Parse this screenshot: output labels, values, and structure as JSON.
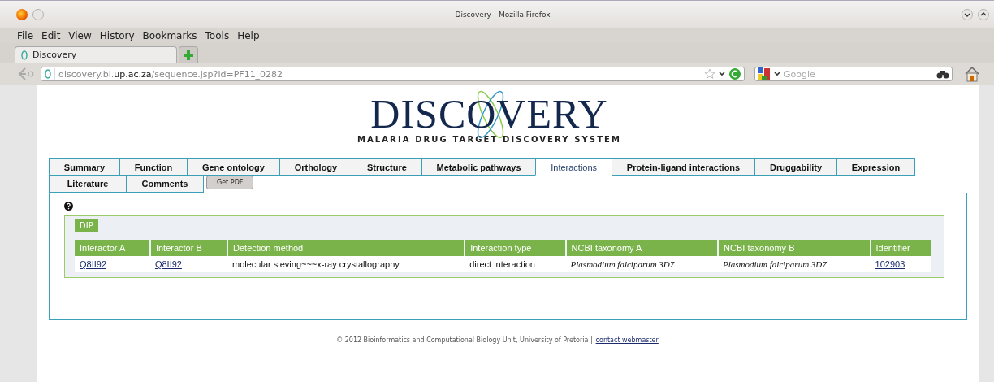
{
  "window": {
    "title": "Discovery - Mozilla Firefox"
  },
  "menu": [
    "File",
    "Edit",
    "View",
    "History",
    "Bookmarks",
    "Tools",
    "Help"
  ],
  "browser_tabs": [
    {
      "label": "Discovery",
      "selected": true
    }
  ],
  "address_bar": {
    "host_pre": "discovery.bi.",
    "host": "up.ac.za",
    "path": "/sequence.jsp?id=PF11_0282"
  },
  "search": {
    "placeholder": "Google"
  },
  "logo": {
    "title": "DISCOVERY",
    "subtitle": "MALARIA DRUG TARGET DISCOVERY SYSTEM"
  },
  "tab_rows": [
    [
      {
        "label": "Summary",
        "selected": false
      },
      {
        "label": "Function",
        "selected": false
      },
      {
        "label": "Gene ontology",
        "selected": false
      },
      {
        "label": "Orthology",
        "selected": false
      },
      {
        "label": "Structure",
        "selected": false
      },
      {
        "label": "Metabolic pathways",
        "selected": false
      },
      {
        "label": "Interactions",
        "selected": true
      },
      {
        "label": "Protein-ligand interactions",
        "selected": false
      },
      {
        "label": "Druggability",
        "selected": false
      },
      {
        "label": "Expression",
        "selected": false
      }
    ],
    [
      {
        "label": "Literature",
        "selected": false
      },
      {
        "label": "Comments",
        "selected": false
      }
    ]
  ],
  "pdf_button": "Get PDF",
  "section": {
    "label": "DIP",
    "columns": [
      "Interactor A",
      "Interactor B",
      "Detection method",
      "Interaction type",
      "NCBI taxonomy A",
      "NCBI taxonomy B",
      "Identifier"
    ],
    "rows": [
      [
        {
          "text": "Q8II92",
          "kind": "link"
        },
        {
          "text": "Q8II92",
          "kind": "link"
        },
        {
          "text": "molecular sieving~~~x-ray crystallography",
          "kind": "plain"
        },
        {
          "text": "direct interaction",
          "kind": "plain"
        },
        {
          "text": "Plasmodium falciparum 3D7",
          "kind": "species"
        },
        {
          "text": "Plasmodium falciparum 3D7",
          "kind": "species"
        },
        {
          "text": "102903",
          "kind": "link"
        }
      ]
    ]
  },
  "footer": {
    "text": "© 2012 Bioinformatics and Computational Biology Unit, University of Pretoria |",
    "link": "contact webmaster"
  }
}
